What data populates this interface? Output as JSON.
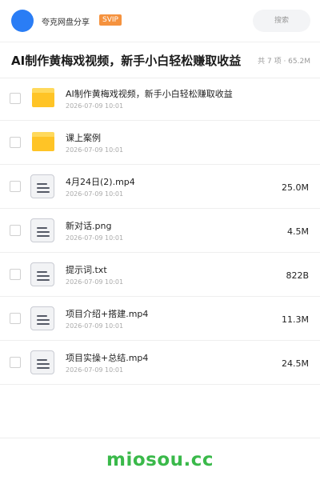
{
  "header": {
    "share_name": "夸克网盘分享",
    "badge": "SVIP",
    "search_label": "搜索"
  },
  "folder": {
    "title": "AI制作黄梅戏视频，新手小白轻松赚取收益",
    "summary": "共 7 项 · 65.2M"
  },
  "files": [
    {
      "name": "AI制作黄梅戏视频，新手小白轻松赚取收益",
      "date": "2026-07-09 10:01",
      "size": "",
      "type": "folder"
    },
    {
      "name": "课上案例",
      "date": "2026-07-09 10:01",
      "size": "",
      "type": "folder"
    },
    {
      "name": "4月24日(2).mp4",
      "date": "2026-07-09 10:01",
      "size": "25.0M",
      "type": "file"
    },
    {
      "name": "新对话.png",
      "date": "2026-07-09 10:01",
      "size": "4.5M",
      "type": "file"
    },
    {
      "name": "提示词.txt",
      "date": "2026-07-09 10:01",
      "size": "822B",
      "type": "file"
    },
    {
      "name": "项目介绍+搭建.mp4",
      "date": "2026-07-09 10:01",
      "size": "11.3M",
      "type": "file"
    },
    {
      "name": "项目实操+总结.mp4",
      "date": "2026-07-09 10:01",
      "size": "24.5M",
      "type": "file"
    }
  ],
  "watermark": "miosou.cc",
  "colors": {
    "accent": "#2a7df5",
    "svip": "#f5923e",
    "folder": "#ffc426",
    "watermark": "#3ab94a"
  }
}
